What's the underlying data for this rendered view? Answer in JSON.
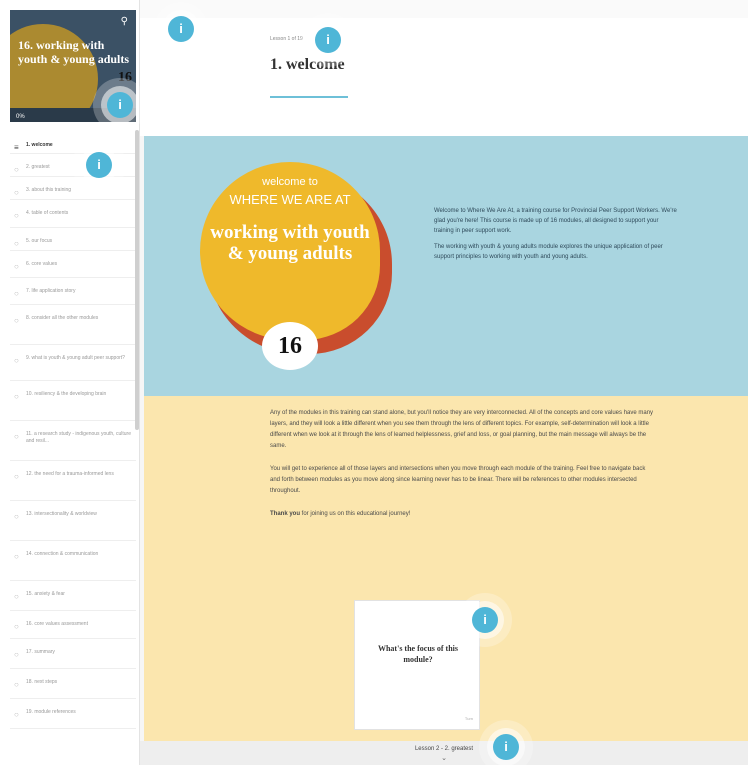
{
  "course": {
    "title": "16. working with youth & young adults",
    "progress": "0%",
    "progress_value": 0,
    "mark": "16"
  },
  "icons": {
    "search": "search-icon",
    "menu": "hamburger-icon",
    "hotspot": "info-icon"
  },
  "lessons": [
    {
      "label": "1. welcome",
      "active": true
    },
    {
      "label": "2. greatest"
    },
    {
      "label": "3. about this training"
    },
    {
      "label": "4. table of contents"
    },
    {
      "label": "5. our focus"
    },
    {
      "label": "6. core values"
    },
    {
      "label": "7. life application story"
    },
    {
      "label": "8. consider all the other modules"
    },
    {
      "label": "9. what is youth & young adult peer support?"
    },
    {
      "label": "10. resiliency & the developing brain"
    },
    {
      "label": "11. a research study - indigenous youth, culture and resil..."
    },
    {
      "label": "12. the need for a trauma-informed lens"
    },
    {
      "label": "13. intersectionality & worldview"
    },
    {
      "label": "14. connection & communication"
    },
    {
      "label": "15. anxiety & fear"
    },
    {
      "label": "16. core values assessment"
    },
    {
      "label": "17. summary"
    },
    {
      "label": "18. next steps"
    },
    {
      "label": "19. module references"
    }
  ],
  "header": {
    "breadcrumb": "Lesson 1 of 19",
    "title": "1. welcome"
  },
  "hero": {
    "welcome_to": "welcome to",
    "where": "WHERE WE ARE AT",
    "module": "working with youth & young adults",
    "p1": "Welcome to Where We Are At, a training course for Provincial Peer Support Workers. We're glad you're here! This course is made up of 16 modules, all designed to support your training in peer support work.",
    "p2": "The working with youth & young adults module explores the unique application of peer support principles to working with youth and young adults."
  },
  "body": {
    "p1": "Any of the modules in this training can stand alone, but you'll notice they are very interconnected. All of the concepts and core values have many layers, and they will look a little different when you see them through the lens of different topics. For example, self-determination will look a little different when we look at it through the lens of learned helplessness, grief and loss, or goal planning, but the main message will always be the same.",
    "p2": "You will get to experience all of those layers and intersections when you move through each module of the training. Feel free to navigate back and forth between modules as you move along since learning never has to be linear. There will be references to other modules intersected throughout.",
    "thanks_bold": "Thank you",
    "thanks_rest": " for joining us on this educational journey!"
  },
  "card": {
    "question": "What's the focus of this module?",
    "flip_label": "Turn"
  },
  "footer": {
    "next": "Lesson 2 - 2. greatest",
    "chevron": "⌄"
  },
  "hotspot_label": "i"
}
